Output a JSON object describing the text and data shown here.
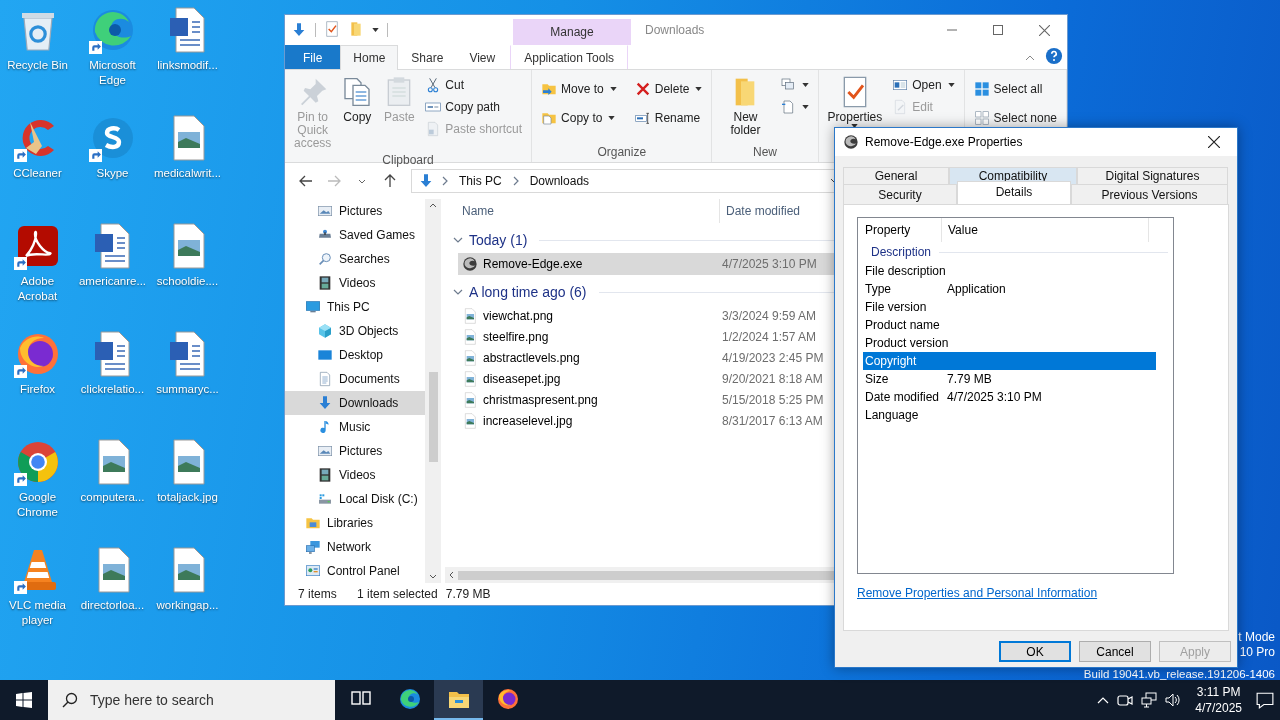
{
  "desktop": {
    "icons": [
      {
        "label": "Recycle Bin",
        "kind": "recycle",
        "shortcut": false
      },
      {
        "label": "CCleaner",
        "kind": "ccleaner",
        "shortcut": true
      },
      {
        "label": "Adobe Acrobat",
        "kind": "acrobat",
        "shortcut": true
      },
      {
        "label": "Firefox",
        "kind": "firefox",
        "shortcut": true
      },
      {
        "label": "Google Chrome",
        "kind": "chrome",
        "shortcut": true
      },
      {
        "label": "VLC media player",
        "kind": "vlc",
        "shortcut": true
      },
      {
        "label": "Microsoft Edge",
        "kind": "edge",
        "shortcut": true
      },
      {
        "label": "Skype",
        "kind": "skype",
        "shortcut": true
      },
      {
        "label": "americanre...",
        "kind": "word",
        "shortcut": false
      },
      {
        "label": "clickrelatio...",
        "kind": "word",
        "shortcut": false
      },
      {
        "label": "computera...",
        "kind": "image",
        "shortcut": false
      },
      {
        "label": "directorloa...",
        "kind": "image",
        "shortcut": false
      },
      {
        "label": "linksmodif...",
        "kind": "word",
        "shortcut": false
      },
      {
        "label": "medicalwrit...",
        "kind": "image",
        "shortcut": false
      },
      {
        "label": "schooldie....",
        "kind": "image",
        "shortcut": false
      },
      {
        "label": "summaryc...",
        "kind": "word",
        "shortcut": false
      },
      {
        "label": "totaljack.jpg",
        "kind": "image",
        "shortcut": false
      },
      {
        "label": "workingap...",
        "kind": "image",
        "shortcut": false
      }
    ],
    "system_watermark": [
      "t Mode",
      "10 Pro",
      "Build 19041.vb_release.191206-1406"
    ]
  },
  "explorer": {
    "title": "Downloads",
    "context_header": "Manage",
    "ribbon_tabs": [
      {
        "label": "File",
        "kind": "file",
        "selected": false
      },
      {
        "label": "Home",
        "kind": "tab",
        "selected": true
      },
      {
        "label": "Share",
        "kind": "tab",
        "selected": false
      },
      {
        "label": "View",
        "kind": "tab",
        "selected": false
      },
      {
        "label": "Application Tools",
        "kind": "context",
        "selected": false
      }
    ],
    "ribbon_groups": [
      {
        "label": "Clipboard",
        "large": [
          {
            "label": "Pin to Quick access",
            "kind": "pin",
            "disabled": true,
            "dropdown": false
          },
          {
            "label": "Copy",
            "kind": "copy",
            "disabled": false,
            "dropdown": false
          },
          {
            "label": "Paste",
            "kind": "paste",
            "disabled": true,
            "dropdown": false
          }
        ],
        "small": [
          {
            "label": "Cut",
            "kind": "cut",
            "disabled": false,
            "dropdown": false
          },
          {
            "label": "Copy path",
            "kind": "path",
            "disabled": false,
            "dropdown": false
          },
          {
            "label": "Paste shortcut",
            "kind": "shortcut",
            "disabled": true,
            "dropdown": false
          }
        ]
      },
      {
        "label": "Organize",
        "small": [
          {
            "label": "Move to",
            "kind": "move",
            "disabled": false,
            "dropdown": true
          },
          {
            "label": "Copy to",
            "kind": "copyto",
            "disabled": false,
            "dropdown": true
          },
          {
            "label": "Delete",
            "kind": "delete",
            "disabled": false,
            "dropdown": true
          },
          {
            "label": "Rename",
            "kind": "rename",
            "disabled": false,
            "dropdown": false
          }
        ]
      },
      {
        "label": "New",
        "large": [
          {
            "label": "New folder",
            "kind": "folder",
            "disabled": false,
            "dropdown": false
          }
        ],
        "small": [
          {
            "kind": "newitem",
            "disabled": false,
            "dropdown": true
          },
          {
            "kind": "easy",
            "disabled": false,
            "dropdown": true
          }
        ]
      },
      {
        "large": [
          {
            "label": "Properties",
            "kind": "properties",
            "disabled": false,
            "dropdown": true
          }
        ],
        "small": [
          {
            "label": "Open",
            "kind": "open",
            "disabled": false,
            "dropdown": true
          },
          {
            "label": "Edit",
            "kind": "edit",
            "disabled": true,
            "dropdown": false
          }
        ]
      },
      {
        "small": [
          {
            "label": "Select all",
            "kind": "selectall",
            "disabled": false,
            "dropdown": false
          },
          {
            "label": "Select none",
            "kind": "selectnone",
            "disabled": false,
            "dropdown": false
          }
        ]
      }
    ],
    "address": [
      "This PC",
      "Downloads"
    ],
    "nav": [
      {
        "children": [
          {
            "label": "Pictures",
            "kind": "pictures",
            "selected": false
          },
          {
            "label": "Saved Games",
            "kind": "games",
            "selected": false
          },
          {
            "label": "Searches",
            "kind": "search",
            "selected": false
          },
          {
            "label": "Videos",
            "kind": "videos",
            "selected": false
          }
        ]
      },
      {
        "label": "This PC",
        "kind": "pc",
        "selected": false,
        "children": [
          {
            "label": "3D Objects",
            "kind": "cube",
            "selected": false
          },
          {
            "label": "Desktop",
            "kind": "desktop",
            "selected": false
          },
          {
            "label": "Documents",
            "kind": "documents",
            "selected": false
          },
          {
            "label": "Downloads",
            "kind": "downloads",
            "selected": true
          },
          {
            "label": "Music",
            "kind": "music",
            "selected": false
          },
          {
            "label": "Pictures",
            "kind": "pictures",
            "selected": false
          },
          {
            "label": "Videos",
            "kind": "videos",
            "selected": false
          },
          {
            "label": "Local Disk (C:)",
            "kind": "disk",
            "selected": false
          }
        ]
      },
      {
        "label": "Libraries",
        "kind": "libraries",
        "selected": false
      },
      {
        "label": "Network",
        "kind": "network",
        "selected": false
      },
      {
        "label": "Control Panel",
        "kind": "control",
        "selected": false
      }
    ],
    "columns": [
      "Name",
      "Date modified"
    ],
    "file_groups": [
      {
        "title": "Today (1)",
        "expanded": true,
        "files": [
          {
            "name": "Remove-Edge.exe",
            "kind": "exe",
            "date": "4/7/2025 3:10 PM",
            "selected": true
          }
        ]
      },
      {
        "title": "A long time ago (6)",
        "expanded": true,
        "files": [
          {
            "name": "viewchat.png",
            "kind": "image",
            "date": "3/3/2024 9:59 AM",
            "selected": false
          },
          {
            "name": "steelfire.png",
            "kind": "image",
            "date": "1/2/2024 1:57 AM",
            "selected": false
          },
          {
            "name": "abstractlevels.png",
            "kind": "image",
            "date": "4/19/2023 2:45 PM",
            "selected": false
          },
          {
            "name": "diseasepet.jpg",
            "kind": "image",
            "date": "9/20/2021 8:18 AM",
            "selected": false
          },
          {
            "name": "christmaspresent.png",
            "kind": "image",
            "date": "5/15/2018 5:25 PM",
            "selected": false
          },
          {
            "name": "increaselevel.jpg",
            "kind": "image",
            "date": "8/31/2017 6:13 AM",
            "selected": false
          }
        ]
      }
    ],
    "status": {
      "count": "7 items",
      "selection": "1 item selected",
      "size": "7.79 MB"
    }
  },
  "dialog": {
    "title": "Remove-Edge.exe Properties",
    "tab_rows": [
      [
        {
          "label": "General",
          "selected": false,
          "hovered": false
        },
        {
          "label": "Compatibility",
          "selected": false,
          "hovered": true
        },
        {
          "label": "Digital Signatures",
          "selected": false,
          "hovered": false
        }
      ],
      [
        {
          "label": "Security",
          "selected": false,
          "hovered": false
        },
        {
          "label": "Details",
          "selected": true,
          "hovered": false
        },
        {
          "label": "Previous Versions",
          "selected": false,
          "hovered": false
        }
      ]
    ],
    "list": {
      "columns": [
        "Property",
        "Value"
      ],
      "section": "Description",
      "rows": [
        {
          "property": "File description",
          "selected": false
        },
        {
          "property": "Type",
          "value": "Application",
          "selected": false
        },
        {
          "property": "File version",
          "selected": false
        },
        {
          "property": "Product name",
          "selected": false
        },
        {
          "property": "Product version",
          "selected": false
        },
        {
          "property": "Copyright",
          "selected": true
        },
        {
          "property": "Size",
          "value": "7.79 MB",
          "selected": false
        },
        {
          "property": "Date modified",
          "value": "4/7/2025 3:10 PM",
          "selected": false
        },
        {
          "property": "Language",
          "selected": false
        }
      ]
    },
    "link": "Remove Properties and Personal Information",
    "buttons": [
      {
        "label": "OK",
        "default": true,
        "disabled": false
      },
      {
        "label": "Cancel",
        "default": false,
        "disabled": false
      },
      {
        "label": "Apply",
        "default": false,
        "disabled": true
      }
    ]
  },
  "taskbar": {
    "search_placeholder": "Type here to search",
    "apps": [
      {
        "kind": "taskview",
        "selected": false
      },
      {
        "kind": "edge",
        "selected": false
      },
      {
        "kind": "explorer",
        "selected": true
      },
      {
        "kind": "firefox",
        "selected": false
      }
    ],
    "time": "3:11 PM",
    "date": "4/7/2025"
  }
}
